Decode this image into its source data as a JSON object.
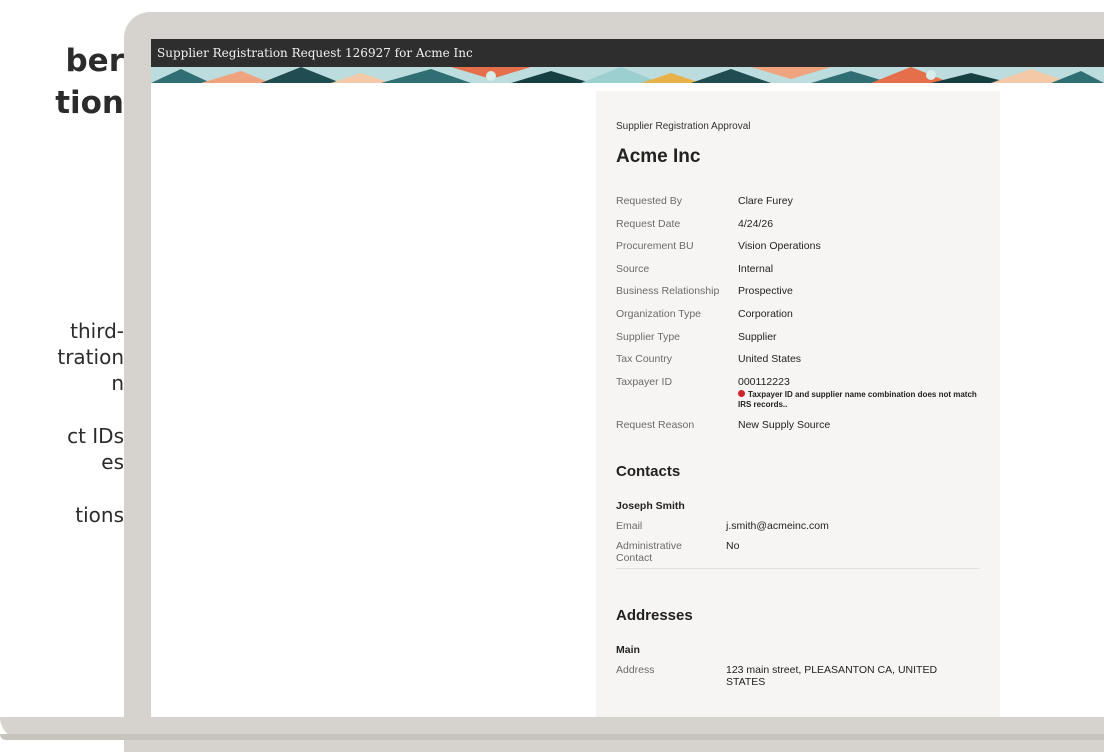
{
  "slide": {
    "title_lines": [
      "ber",
      "tion"
    ],
    "bullets": [
      [
        "third-",
        "tration",
        "n"
      ],
      [
        "ct IDs",
        "es"
      ],
      [
        "tions"
      ]
    ]
  },
  "window": {
    "title": "Supplier Registration Request 126927 for Acme Inc"
  },
  "panel": {
    "eyebrow": "Supplier Registration Approval",
    "company": "Acme Inc",
    "fields": [
      {
        "label": "Requested By",
        "value": "Clare Furey"
      },
      {
        "label": "Request Date",
        "value": "4/24/26"
      },
      {
        "label": "Procurement BU",
        "value": "Vision Operations"
      },
      {
        "label": "Source",
        "value": "Internal"
      },
      {
        "label": "Business Relationship",
        "value": "Prospective"
      },
      {
        "label": "Organization Type",
        "value": "Corporation"
      },
      {
        "label": "Supplier Type",
        "value": "Supplier"
      },
      {
        "label": "Tax Country",
        "value": "United States"
      },
      {
        "label": "Taxpayer ID",
        "value": "000112223"
      }
    ],
    "taxpayer_error": "Taxpayer ID and supplier name combination does not match IRS records..",
    "reason": {
      "label": "Request Reason",
      "value": "New Supply Source"
    },
    "contacts": {
      "title": "Contacts",
      "name": "Joseph Smith",
      "email_label": "Email",
      "email": "j.smith@acmeinc.com",
      "admin_label": "Administrative Contact",
      "admin_value": "No"
    },
    "addresses": {
      "title": "Addresses",
      "name": "Main",
      "address_label": "Address",
      "address_value": "123 main street, PLEASANTON CA, UNITED STATES"
    }
  },
  "colors": {
    "titlebar": "#2e2e2e",
    "bezel": "#d6d3ce",
    "panel": "#f6f5f3",
    "error": "#d3212c"
  }
}
